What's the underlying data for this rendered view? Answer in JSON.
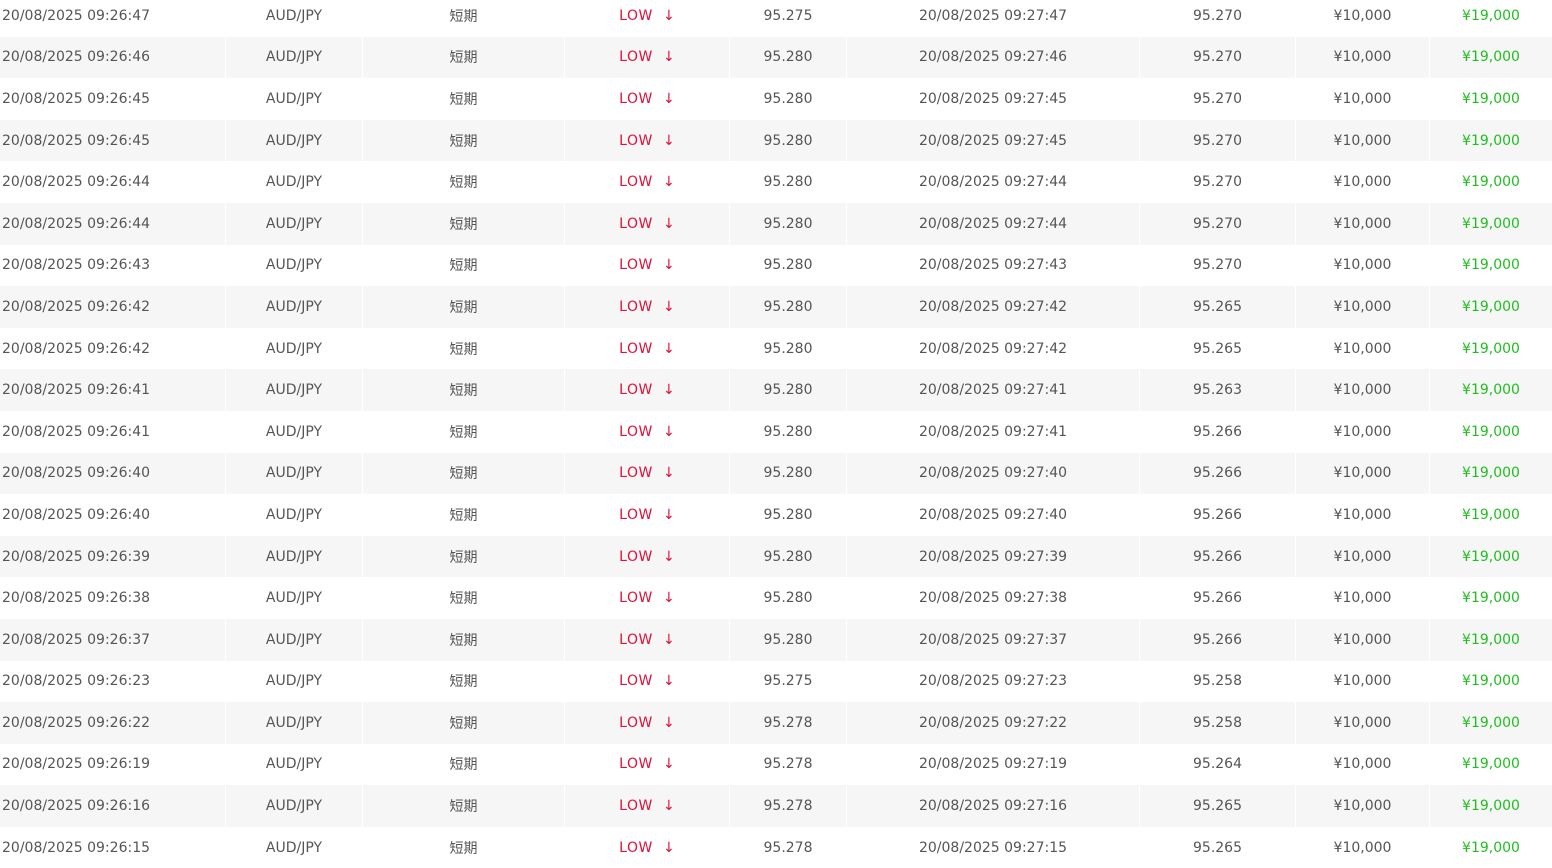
{
  "colors": {
    "low": "#e0103a",
    "payout": "#1fbf1f",
    "text": "#555555",
    "stripe": "#f6f6f6"
  },
  "icons": {
    "direction": "arrow-down-icon"
  },
  "rows": [
    {
      "open_time": "20/08/2025 09:26:47",
      "pair": "AUD/JPY",
      "type": "短期",
      "direction": "LOW",
      "open_price": "95.275",
      "close_time": "20/08/2025 09:27:47",
      "close_price": "95.270",
      "amount": "¥10,000",
      "payout": "¥19,000"
    },
    {
      "open_time": "20/08/2025 09:26:46",
      "pair": "AUD/JPY",
      "type": "短期",
      "direction": "LOW",
      "open_price": "95.280",
      "close_time": "20/08/2025 09:27:46",
      "close_price": "95.270",
      "amount": "¥10,000",
      "payout": "¥19,000"
    },
    {
      "open_time": "20/08/2025 09:26:45",
      "pair": "AUD/JPY",
      "type": "短期",
      "direction": "LOW",
      "open_price": "95.280",
      "close_time": "20/08/2025 09:27:45",
      "close_price": "95.270",
      "amount": "¥10,000",
      "payout": "¥19,000"
    },
    {
      "open_time": "20/08/2025 09:26:45",
      "pair": "AUD/JPY",
      "type": "短期",
      "direction": "LOW",
      "open_price": "95.280",
      "close_time": "20/08/2025 09:27:45",
      "close_price": "95.270",
      "amount": "¥10,000",
      "payout": "¥19,000"
    },
    {
      "open_time": "20/08/2025 09:26:44",
      "pair": "AUD/JPY",
      "type": "短期",
      "direction": "LOW",
      "open_price": "95.280",
      "close_time": "20/08/2025 09:27:44",
      "close_price": "95.270",
      "amount": "¥10,000",
      "payout": "¥19,000"
    },
    {
      "open_time": "20/08/2025 09:26:44",
      "pair": "AUD/JPY",
      "type": "短期",
      "direction": "LOW",
      "open_price": "95.280",
      "close_time": "20/08/2025 09:27:44",
      "close_price": "95.270",
      "amount": "¥10,000",
      "payout": "¥19,000"
    },
    {
      "open_time": "20/08/2025 09:26:43",
      "pair": "AUD/JPY",
      "type": "短期",
      "direction": "LOW",
      "open_price": "95.280",
      "close_time": "20/08/2025 09:27:43",
      "close_price": "95.270",
      "amount": "¥10,000",
      "payout": "¥19,000"
    },
    {
      "open_time": "20/08/2025 09:26:42",
      "pair": "AUD/JPY",
      "type": "短期",
      "direction": "LOW",
      "open_price": "95.280",
      "close_time": "20/08/2025 09:27:42",
      "close_price": "95.265",
      "amount": "¥10,000",
      "payout": "¥19,000"
    },
    {
      "open_time": "20/08/2025 09:26:42",
      "pair": "AUD/JPY",
      "type": "短期",
      "direction": "LOW",
      "open_price": "95.280",
      "close_time": "20/08/2025 09:27:42",
      "close_price": "95.265",
      "amount": "¥10,000",
      "payout": "¥19,000"
    },
    {
      "open_time": "20/08/2025 09:26:41",
      "pair": "AUD/JPY",
      "type": "短期",
      "direction": "LOW",
      "open_price": "95.280",
      "close_time": "20/08/2025 09:27:41",
      "close_price": "95.263",
      "amount": "¥10,000",
      "payout": "¥19,000"
    },
    {
      "open_time": "20/08/2025 09:26:41",
      "pair": "AUD/JPY",
      "type": "短期",
      "direction": "LOW",
      "open_price": "95.280",
      "close_time": "20/08/2025 09:27:41",
      "close_price": "95.266",
      "amount": "¥10,000",
      "payout": "¥19,000"
    },
    {
      "open_time": "20/08/2025 09:26:40",
      "pair": "AUD/JPY",
      "type": "短期",
      "direction": "LOW",
      "open_price": "95.280",
      "close_time": "20/08/2025 09:27:40",
      "close_price": "95.266",
      "amount": "¥10,000",
      "payout": "¥19,000"
    },
    {
      "open_time": "20/08/2025 09:26:40",
      "pair": "AUD/JPY",
      "type": "短期",
      "direction": "LOW",
      "open_price": "95.280",
      "close_time": "20/08/2025 09:27:40",
      "close_price": "95.266",
      "amount": "¥10,000",
      "payout": "¥19,000"
    },
    {
      "open_time": "20/08/2025 09:26:39",
      "pair": "AUD/JPY",
      "type": "短期",
      "direction": "LOW",
      "open_price": "95.280",
      "close_time": "20/08/2025 09:27:39",
      "close_price": "95.266",
      "amount": "¥10,000",
      "payout": "¥19,000"
    },
    {
      "open_time": "20/08/2025 09:26:38",
      "pair": "AUD/JPY",
      "type": "短期",
      "direction": "LOW",
      "open_price": "95.280",
      "close_time": "20/08/2025 09:27:38",
      "close_price": "95.266",
      "amount": "¥10,000",
      "payout": "¥19,000"
    },
    {
      "open_time": "20/08/2025 09:26:37",
      "pair": "AUD/JPY",
      "type": "短期",
      "direction": "LOW",
      "open_price": "95.280",
      "close_time": "20/08/2025 09:27:37",
      "close_price": "95.266",
      "amount": "¥10,000",
      "payout": "¥19,000"
    },
    {
      "open_time": "20/08/2025 09:26:23",
      "pair": "AUD/JPY",
      "type": "短期",
      "direction": "LOW",
      "open_price": "95.275",
      "close_time": "20/08/2025 09:27:23",
      "close_price": "95.258",
      "amount": "¥10,000",
      "payout": "¥19,000"
    },
    {
      "open_time": "20/08/2025 09:26:22",
      "pair": "AUD/JPY",
      "type": "短期",
      "direction": "LOW",
      "open_price": "95.278",
      "close_time": "20/08/2025 09:27:22",
      "close_price": "95.258",
      "amount": "¥10,000",
      "payout": "¥19,000"
    },
    {
      "open_time": "20/08/2025 09:26:19",
      "pair": "AUD/JPY",
      "type": "短期",
      "direction": "LOW",
      "open_price": "95.278",
      "close_time": "20/08/2025 09:27:19",
      "close_price": "95.264",
      "amount": "¥10,000",
      "payout": "¥19,000"
    },
    {
      "open_time": "20/08/2025 09:26:16",
      "pair": "AUD/JPY",
      "type": "短期",
      "direction": "LOW",
      "open_price": "95.278",
      "close_time": "20/08/2025 09:27:16",
      "close_price": "95.265",
      "amount": "¥10,000",
      "payout": "¥19,000"
    },
    {
      "open_time": "20/08/2025 09:26:15",
      "pair": "AUD/JPY",
      "type": "短期",
      "direction": "LOW",
      "open_price": "95.278",
      "close_time": "20/08/2025 09:27:15",
      "close_price": "95.265",
      "amount": "¥10,000",
      "payout": "¥19,000"
    }
  ]
}
